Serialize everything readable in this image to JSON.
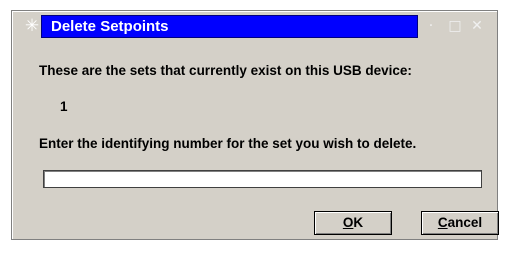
{
  "window": {
    "title": "Delete Setpoints",
    "system_icon": "✳",
    "minimize_glyph": "·",
    "maximize_glyph": "□",
    "close_glyph": "✕"
  },
  "content": {
    "message": "These are the sets that currently exist on this USB device:",
    "set_list": "1",
    "prompt": "Enter the identifying number for the set you wish to delete."
  },
  "input": {
    "value": "",
    "placeholder": ""
  },
  "buttons": {
    "ok": {
      "accel": "O",
      "rest": "K"
    },
    "cancel": {
      "accel": "C",
      "rest": "ancel"
    }
  },
  "colors": {
    "title_bar": "#0000ff",
    "dialog_face": "#d4d0c8",
    "text": "#000000"
  },
  "icons": {
    "system": "app-menu-icon",
    "minimize": "minimize-icon",
    "maximize": "maximize-icon",
    "close": "close-icon"
  }
}
